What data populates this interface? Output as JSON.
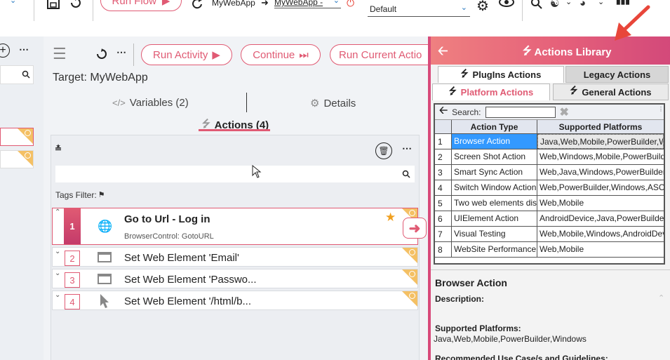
{
  "toolbar": {
    "run_flow_label": "Run Flow",
    "app_name": "MyWebApp",
    "app_select_value": "MyWebApp -",
    "environment_value": "Default"
  },
  "main": {
    "buttons": {
      "run_activity": "Run Activity",
      "continue": "Continue",
      "run_current": "Run Current Actio"
    },
    "target_label": "Target: MyWebApp",
    "tabs": {
      "variables": "Variables (2)",
      "details": "Details",
      "actions": "Actions (4)"
    },
    "tags_filter_label": "Tags Filter:",
    "actions": [
      {
        "num": "1",
        "title": "Go to Url - Log in",
        "subtitle": "BrowserControl: GotoURL"
      },
      {
        "num": "2",
        "title": "Set Web Element 'Email'"
      },
      {
        "num": "3",
        "title": "Set Web Element 'Passwo..."
      },
      {
        "num": "4",
        "title": "Set Web Element '/html/b..."
      }
    ]
  },
  "library": {
    "title": "Actions Library",
    "tabs": {
      "plugins": "PlugIns Actions",
      "legacy": "Legacy Actions",
      "platform": "Platform Actions",
      "general": "General Actions"
    },
    "search_label": "Search:",
    "search_value": "",
    "columns": [
      "Action Type",
      "Supported Platforms"
    ],
    "rows": [
      {
        "n": "1",
        "type": "Browser Action",
        "platforms": "Java,Web,Mobile,PowerBuilder,W"
      },
      {
        "n": "2",
        "type": "Screen Shot Action",
        "platforms": "Web,Windows,Mobile,PowerBuild"
      },
      {
        "n": "3",
        "type": "Smart Sync Action",
        "platforms": "Web,Java,Windows,PowerBuilder"
      },
      {
        "n": "4",
        "type": "Switch Window Action",
        "platforms": "Web,PowerBuilder,Windows,ASCF"
      },
      {
        "n": "5",
        "type": "Two web elements dis",
        "platforms": "Web,Mobile"
      },
      {
        "n": "6",
        "type": "UIElement Action",
        "platforms": "AndroidDevice,Java,PowerBuilder,"
      },
      {
        "n": "7",
        "type": "Visual Testing",
        "platforms": "Web,Mobile,Windows,AndroidDev"
      },
      {
        "n": "8",
        "type": "WebSite Performance",
        "platforms": "Web,Mobile"
      }
    ],
    "detail": {
      "name": "Browser Action",
      "description_label": "Description:",
      "supported_label": "Supported Platforms:",
      "supported_value": "Java,Web,Mobile,PowerBuilder,Windows",
      "recommended_label": "Recommended Use Case/s and Guidelines:"
    }
  },
  "colors": {
    "accent": "#e05a73",
    "header_gradient_start": "#ef8080",
    "header_gradient_end": "#d3497a",
    "selection": "#3399ff",
    "arrow": "#e8463a"
  }
}
